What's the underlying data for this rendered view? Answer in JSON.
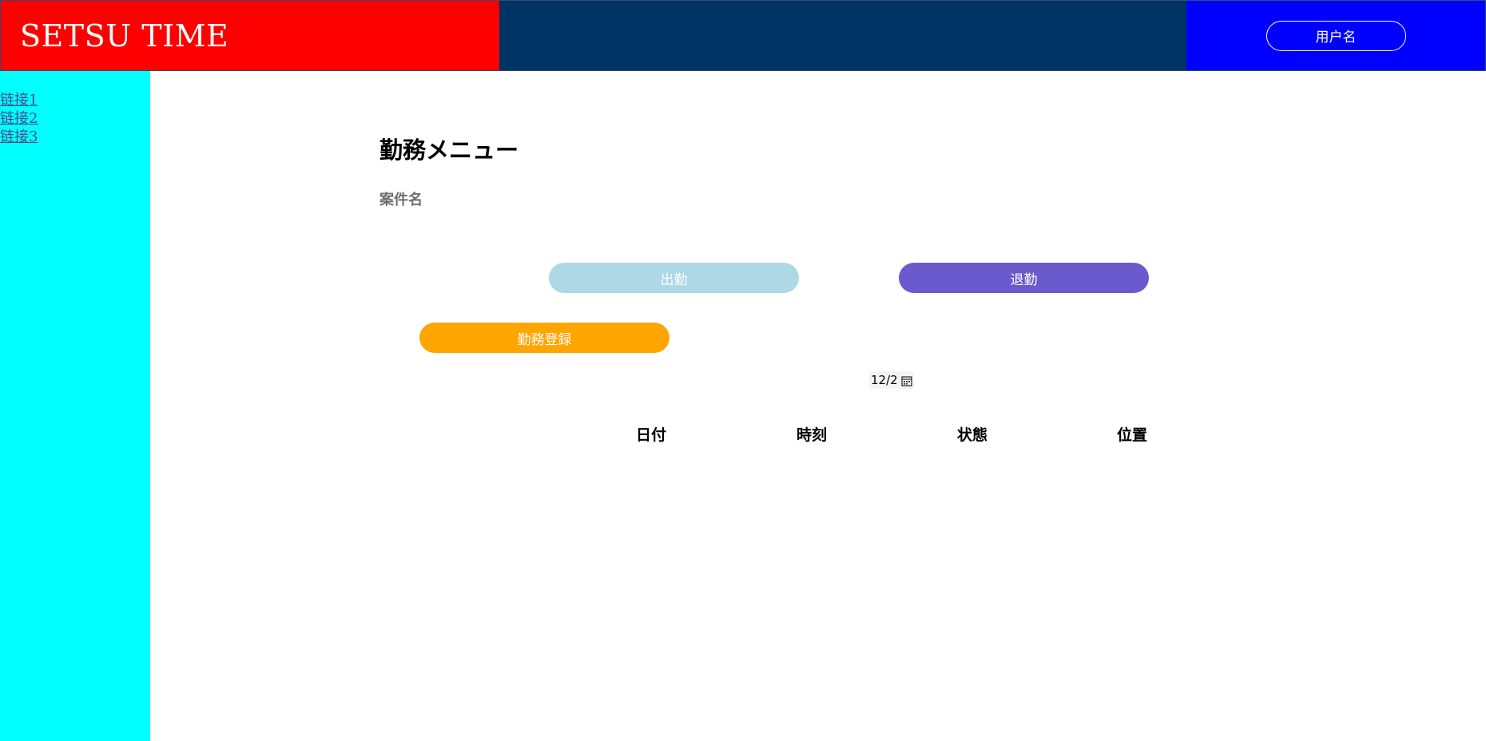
{
  "header": {
    "brand": "SETSU TIME",
    "user_button": "用户名",
    "colors": {
      "brand_bg": "#ff0000",
      "mid_bg": "#003366",
      "user_bg": "#0000ff"
    }
  },
  "sidebar": {
    "links": [
      {
        "label": "链接1"
      },
      {
        "label": "链接2"
      },
      {
        "label": "链接3"
      }
    ],
    "color": "#00ffff"
  },
  "main": {
    "title": "勤務メニュー",
    "project_label": "案件名",
    "buttons": {
      "clock_in": "出勤",
      "clock_out": "退勤",
      "register": "勤務登録"
    },
    "button_colors": {
      "clock_in": "#add8e6",
      "clock_out": "#6a5acd",
      "register": "#ffa500"
    },
    "date_picker": {
      "value": "12/2",
      "icon": "calendar-icon"
    },
    "table": {
      "headers": [
        "日付",
        "時刻",
        "状態",
        "位置"
      ],
      "rows": []
    }
  }
}
